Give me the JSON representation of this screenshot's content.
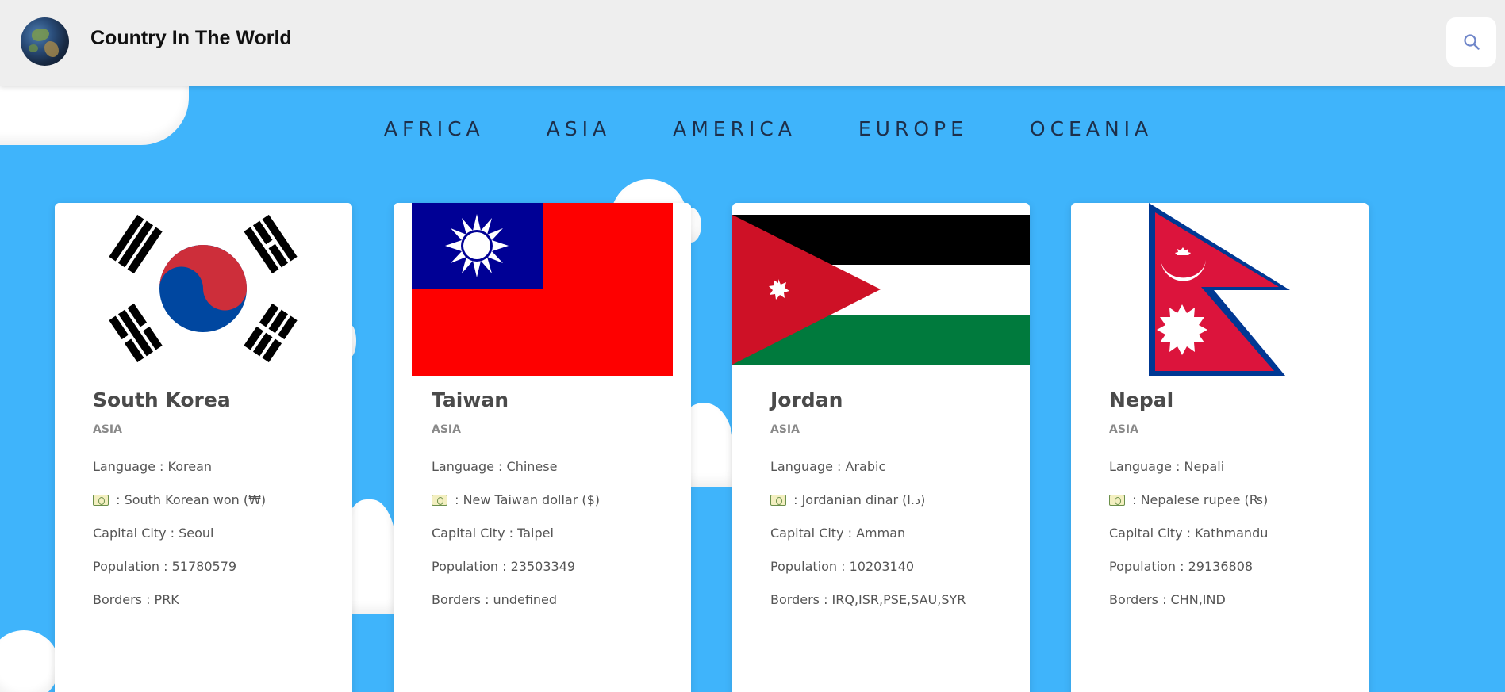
{
  "header": {
    "title": "Country In The World",
    "logo_icon": "earth-globe-icon",
    "search_icon": "search-icon"
  },
  "nav": {
    "items": [
      "AFRICA",
      "ASIA",
      "AMERICA",
      "EUROPE",
      "OCEANIA"
    ]
  },
  "cards": [
    {
      "name": "South Korea",
      "region": "ASIA",
      "language": "Language : Korean",
      "currency": ": South Korean won (₩)",
      "capital": "Capital City : Seoul",
      "population": "Population : 51780579",
      "borders": "Borders : PRK",
      "flag": "south-korea-flag"
    },
    {
      "name": "Taiwan",
      "region": "ASIA",
      "language": "Language : Chinese",
      "currency": ": New Taiwan dollar ($)",
      "capital": "Capital City : Taipei",
      "population": "Population : 23503349",
      "borders": "Borders : undefined",
      "flag": "taiwan-flag"
    },
    {
      "name": "Jordan",
      "region": "ASIA",
      "language": "Language : Arabic",
      "currency": ": Jordanian dinar (د.ا)",
      "capital": "Capital City : Amman",
      "population": "Population : 10203140",
      "borders": "Borders : IRQ,ISR,PSE,SAU,SYR",
      "flag": "jordan-flag"
    },
    {
      "name": "Nepal",
      "region": "ASIA",
      "language": "Language : Nepali",
      "currency": ": Nepalese rupee (₨)",
      "capital": "Capital City : Kathmandu",
      "population": "Population : 29136808",
      "borders": "Borders : CHN,IND",
      "flag": "nepal-flag"
    }
  ],
  "colors": {
    "background": "#3fb4fb",
    "header": "#eeeeee",
    "nav_text": "#1d2f4a"
  }
}
